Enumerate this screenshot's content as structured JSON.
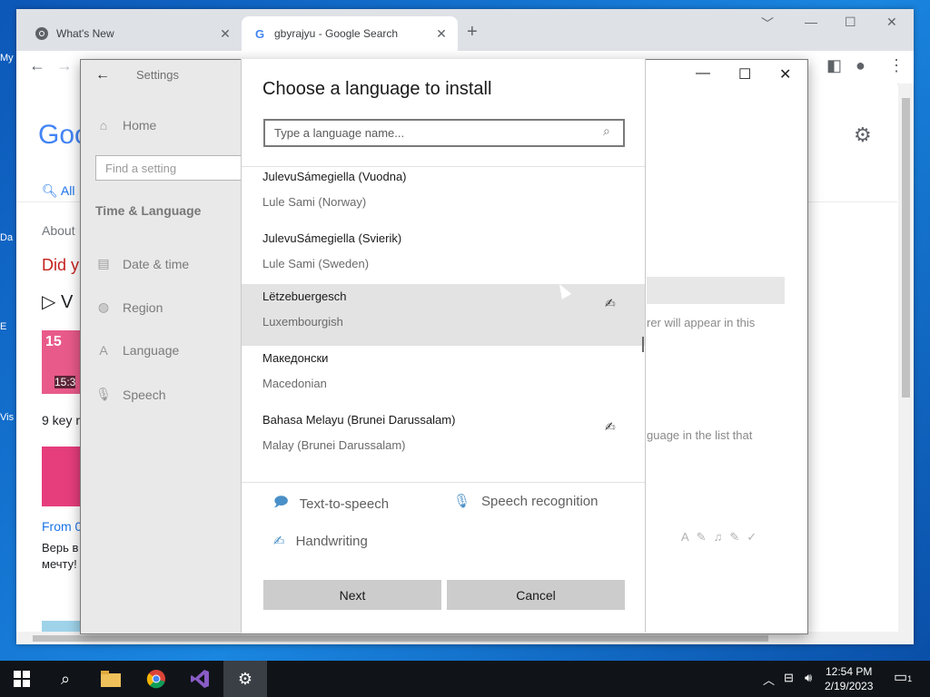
{
  "desktop": {
    "items": [
      "My",
      "Da",
      "E",
      "Vis"
    ]
  },
  "browser": {
    "tabs": [
      {
        "title": "What's New",
        "icon": "chrome-icon",
        "close": "✕"
      },
      {
        "title": "gbyrajyu - Google Search",
        "icon": "google-icon",
        "close": "✕"
      }
    ],
    "new_tab": "+",
    "page": {
      "logo_text": "Goo",
      "tab_all": "All",
      "about": "About",
      "did_you": "Did y",
      "video_v": "V",
      "thumb_time": "15:3",
      "thumb_badge": "15",
      "key_text": "9 key r",
      "from_text": "From 0",
      "ru_line1": "Верь в",
      "ru_line2": "мечту!"
    }
  },
  "settings": {
    "title": "Settings",
    "nav": {
      "home": "Home",
      "search_placeholder": "Find a setting",
      "section": "Time & Language",
      "items": [
        "Date & time",
        "Region",
        "Language",
        "Speech"
      ]
    },
    "right": {
      "text1": "rer will appear in this",
      "text2": "guage in the list that"
    }
  },
  "dialog": {
    "title": "Choose a language to install",
    "search_placeholder": "Type a language name...",
    "languages": [
      {
        "name": "JulevuSámegiella (Vuodna)",
        "sub": "Lule Sami (Norway)",
        "handwriting": false
      },
      {
        "name": "JulevuSámegiella (Svierik)",
        "sub": "Lule Sami (Sweden)",
        "handwriting": false
      },
      {
        "name": "Lëtzebuergesch",
        "sub": "Luxembourgish",
        "handwriting": true,
        "selected": true
      },
      {
        "name": "Македонски",
        "sub": "Macedonian",
        "handwriting": false
      },
      {
        "name": "Bahasa Melayu (Brunei Darussalam)",
        "sub": "Malay (Brunei Darussalam)",
        "handwriting": true
      }
    ],
    "features": {
      "tts": "Text-to-speech",
      "speech": "Speech recognition",
      "handwriting": "Handwriting"
    },
    "buttons": {
      "next": "Next",
      "cancel": "Cancel"
    }
  },
  "taskbar": {
    "time": "12:54 PM",
    "date": "2/19/2023",
    "notifications": "1"
  }
}
